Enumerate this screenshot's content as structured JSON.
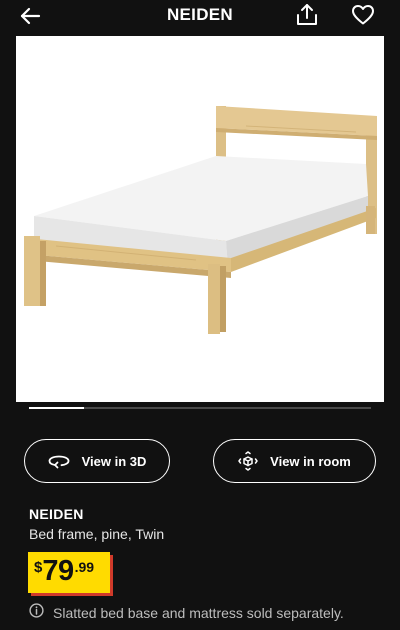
{
  "header": {
    "title": "NEIDEN",
    "back_icon": "arrow-left-icon",
    "share_icon": "share-icon",
    "favorite_icon": "heart-outline-icon"
  },
  "gallery": {
    "image_alt": "pine bed frame with white mattress",
    "position": 1,
    "visible_fraction": 0.16
  },
  "actions": {
    "view_3d_label": "View in 3D",
    "view_3d_icon": "rotate-3d-icon",
    "view_room_label": "View in room",
    "view_room_icon": "ar-room-icon"
  },
  "product": {
    "name": "NEIDEN",
    "description": "Bed frame, pine, Twin",
    "price": {
      "currency": "$",
      "integer": "79",
      "decimal": ".99"
    },
    "notice": "Slatted bed base and mattress sold separately.",
    "notice_icon": "info-icon"
  },
  "colors": {
    "background": "#111111",
    "price_tag": "#ffdb00",
    "price_tag_shadow": "#d03a2a",
    "text": "#ffffff",
    "muted_text": "#bdbdbd"
  }
}
